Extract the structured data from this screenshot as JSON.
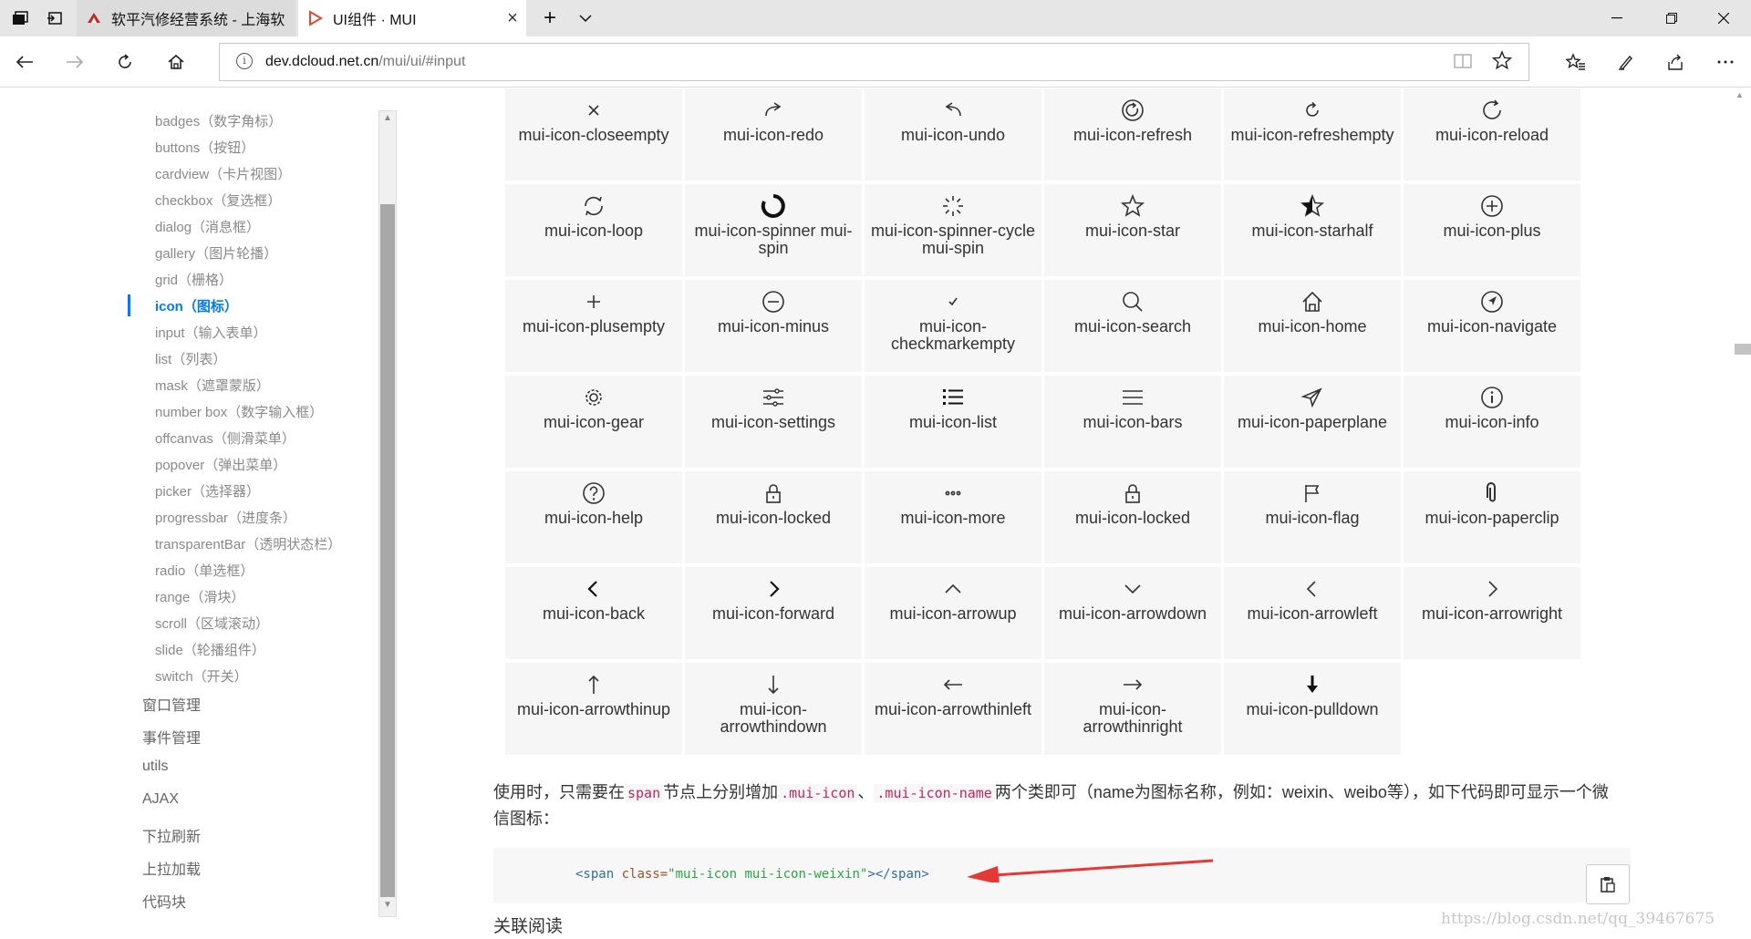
{
  "browser": {
    "tabs": [
      {
        "label": "软平汽修经营系统 - 上海软",
        "active": false
      },
      {
        "label": "UI组件 · MUI",
        "active": true
      }
    ],
    "address": {
      "host": "dev.dcloud.net.cn",
      "path": "/mui/ui/#input"
    }
  },
  "sidebar": {
    "items": [
      {
        "label": "badges（数字角标）"
      },
      {
        "label": "buttons（按钮）"
      },
      {
        "label": "cardview（卡片视图）"
      },
      {
        "label": "checkbox（复选框）"
      },
      {
        "label": "dialog（消息框）"
      },
      {
        "label": "gallery（图片轮播）"
      },
      {
        "label": "grid（栅格）"
      },
      {
        "label": "icon（图标）",
        "active": true
      },
      {
        "label": "input（输入表单）"
      },
      {
        "label": "list（列表）"
      },
      {
        "label": "mask（遮罩蒙版）"
      },
      {
        "label": "number box（数字输入框）"
      },
      {
        "label": "offcanvas（侧滑菜单）"
      },
      {
        "label": "popover（弹出菜单）"
      },
      {
        "label": "picker（选择器）"
      },
      {
        "label": "progressbar（进度条）"
      },
      {
        "label": "transparentBar（透明状态栏）"
      },
      {
        "label": "radio（单选框）"
      },
      {
        "label": "range（滑块）"
      },
      {
        "label": "scroll（区域滚动）"
      },
      {
        "label": "slide（轮播组件）"
      },
      {
        "label": "switch（开关）"
      }
    ],
    "sections": [
      {
        "label": "窗口管理"
      },
      {
        "label": "事件管理"
      },
      {
        "label": "utils"
      },
      {
        "label": "AJAX"
      },
      {
        "label": "下拉刷新"
      },
      {
        "label": "上拉加载"
      },
      {
        "label": "代码块"
      }
    ]
  },
  "icons": [
    {
      "name": "mui-icon-closeempty",
      "icon": "close-icon"
    },
    {
      "name": "mui-icon-redo",
      "icon": "redo-icon"
    },
    {
      "name": "mui-icon-undo",
      "icon": "undo-icon"
    },
    {
      "name": "mui-icon-refresh",
      "icon": "refresh-icon"
    },
    {
      "name": "mui-icon-refreshempty",
      "icon": "refreshempty-icon"
    },
    {
      "name": "mui-icon-reload",
      "icon": "reload-icon"
    },
    {
      "name": "mui-icon-loop",
      "icon": "loop-icon"
    },
    {
      "name": "mui-icon-spinner mui-spin",
      "icon": "spinner-icon"
    },
    {
      "name": "mui-icon-spinner-cycle mui-spin",
      "icon": "spinner-cycle-icon"
    },
    {
      "name": "mui-icon-star",
      "icon": "star-icon"
    },
    {
      "name": "mui-icon-starhalf",
      "icon": "starhalf-icon"
    },
    {
      "name": "mui-icon-plus",
      "icon": "plus-icon"
    },
    {
      "name": "mui-icon-plusempty",
      "icon": "plusempty-icon"
    },
    {
      "name": "mui-icon-minus",
      "icon": "minus-icon"
    },
    {
      "name": "mui-icon-checkmarkempty",
      "icon": "checkmark-icon"
    },
    {
      "name": "mui-icon-search",
      "icon": "search-icon"
    },
    {
      "name": "mui-icon-home",
      "icon": "home-icon"
    },
    {
      "name": "mui-icon-navigate",
      "icon": "navigate-icon"
    },
    {
      "name": "mui-icon-gear",
      "icon": "gear-icon"
    },
    {
      "name": "mui-icon-settings",
      "icon": "settings-icon"
    },
    {
      "name": "mui-icon-list",
      "icon": "list-icon"
    },
    {
      "name": "mui-icon-bars",
      "icon": "bars-icon"
    },
    {
      "name": "mui-icon-paperplane",
      "icon": "paperplane-icon"
    },
    {
      "name": "mui-icon-info",
      "icon": "info-icon"
    },
    {
      "name": "mui-icon-help",
      "icon": "help-icon"
    },
    {
      "name": "mui-icon-locked",
      "icon": "lock-icon"
    },
    {
      "name": "mui-icon-more",
      "icon": "more-icon"
    },
    {
      "name": "mui-icon-locked",
      "icon": "lock-icon"
    },
    {
      "name": "mui-icon-flag",
      "icon": "flag-icon"
    },
    {
      "name": "mui-icon-paperclip",
      "icon": "paperclip-icon"
    },
    {
      "name": "mui-icon-back",
      "icon": "back-icon"
    },
    {
      "name": "mui-icon-forward",
      "icon": "forward-icon"
    },
    {
      "name": "mui-icon-arrowup",
      "icon": "arrowup-icon"
    },
    {
      "name": "mui-icon-arrowdown",
      "icon": "arrowdown-icon"
    },
    {
      "name": "mui-icon-arrowleft",
      "icon": "arrowleft-icon"
    },
    {
      "name": "mui-icon-arrowright",
      "icon": "arrowright-icon"
    },
    {
      "name": "mui-icon-arrowthinup",
      "icon": "arrowthinup-icon"
    },
    {
      "name": "mui-icon-arrowthindown",
      "icon": "arrowthindown-icon"
    },
    {
      "name": "mui-icon-arrowthinleft",
      "icon": "arrowthinleft-icon"
    },
    {
      "name": "mui-icon-arrowthinright",
      "icon": "arrowthinright-icon"
    },
    {
      "name": "mui-icon-pulldown",
      "icon": "pulldown-icon"
    }
  ],
  "content": {
    "para_1": "使用时，只需要在",
    "code_span": "span",
    "para_2": "节点上分别增加",
    "code_class1": ".mui-icon",
    "para_sep": "、",
    "code_class2": ".mui-icon-name",
    "para_3": "两个类即可（name为图标名称，例如：weixin、weibo等），如下代码即可显示一个微信图标：",
    "code_line": {
      "tag_open": "<span",
      "attr": " class=",
      "value": "\"mui-icon mui-icon-weixin\"",
      "tag_close": "></span>"
    },
    "heading": "关联阅读",
    "watermark": "https://blog.csdn.net/qq_39467675"
  },
  "colors": {
    "accent": "#007aff",
    "arrow": "#e53935",
    "cell_bg": "#f6f6f6"
  }
}
